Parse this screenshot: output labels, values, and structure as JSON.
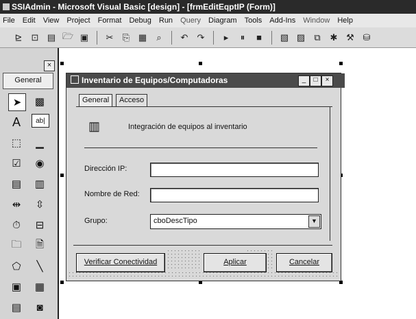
{
  "ide": {
    "title": "SSIAdmin - Microsoft Visual Basic [design] - [frmEditEqptIP (Form)]",
    "menu": [
      "File",
      "Edit",
      "View",
      "Project",
      "Format",
      "Debug",
      "Run",
      "Query",
      "Diagram",
      "Tools",
      "Add-Ins",
      "Window",
      "Help"
    ]
  },
  "toolbox": {
    "close_label": "×",
    "tab_label": "General",
    "text_tool_glyph": "A",
    "textbox_tool_glyph": "ab|"
  },
  "form": {
    "title": "Inventario de Equipos/Computadoras",
    "tabs": [
      "General",
      "Acceso"
    ],
    "header_text": "Integración de equipos al inventario",
    "fields": {
      "ip_label": "Dirección IP:",
      "network_label": "Nombre de Red:",
      "group_label": "Grupo:",
      "group_value": "cboDescTipo"
    },
    "buttons": {
      "verify": "Verificar Conectividad",
      "apply": "Aplicar",
      "cancel": "Cancelar"
    },
    "caption_buttons": [
      "_",
      "□",
      "×"
    ]
  }
}
